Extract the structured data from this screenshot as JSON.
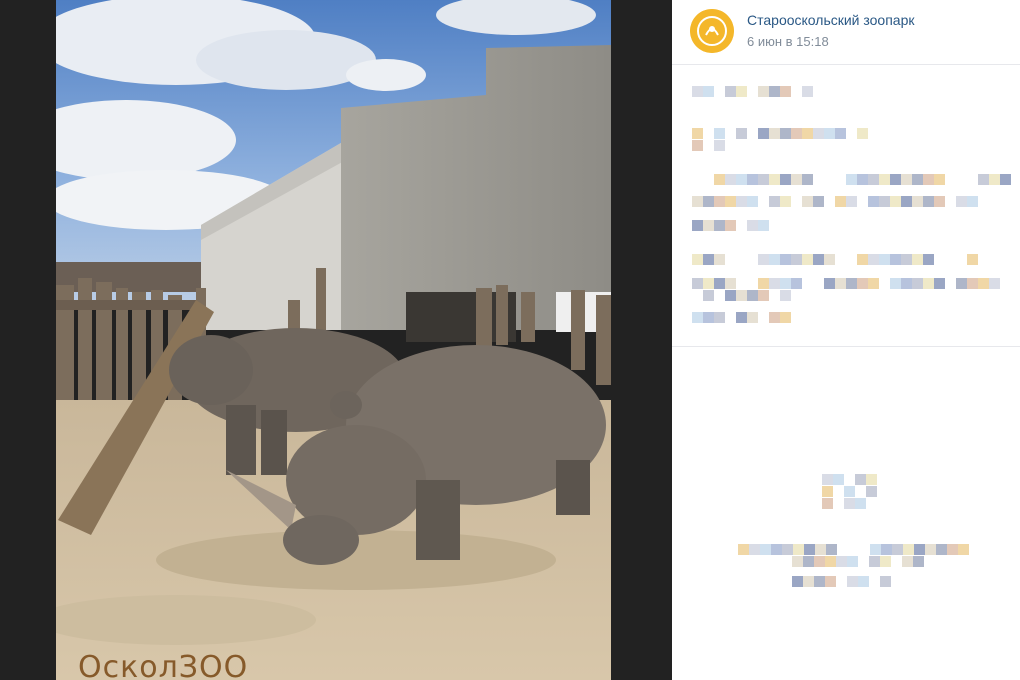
{
  "photo": {
    "watermark": "ОсколЗОО"
  },
  "post": {
    "group_name": "Старооскольский зоопарк",
    "date": "6 июн в 15:18"
  },
  "colors": {
    "accent_link": "#2a5885",
    "meta_gray": "#818c99",
    "avatar_bg": "#f4b72a"
  }
}
